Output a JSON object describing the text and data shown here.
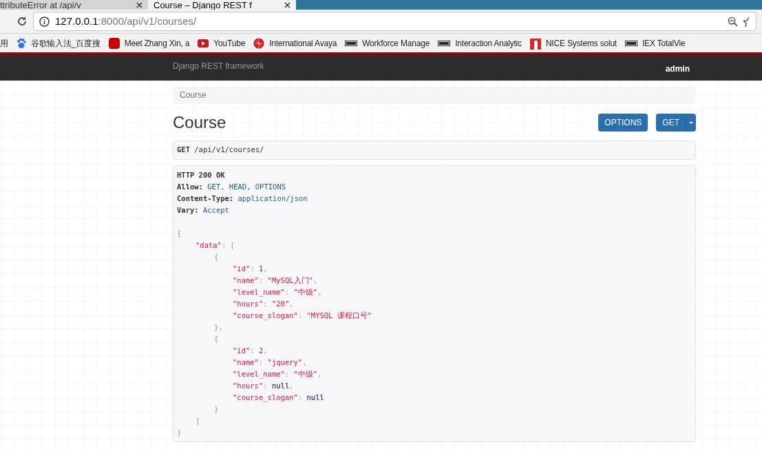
{
  "browser": {
    "tabs": [
      {
        "title": "ttributeError at /api/v",
        "selected": false
      },
      {
        "title": "Course – Django REST f",
        "selected": true
      }
    ],
    "address": {
      "host": "127.0.0.1",
      "rest": ":8000/api/v1/courses/"
    },
    "bookmarks": [
      {
        "label": "用",
        "kind": "text"
      },
      {
        "label": "谷歌输入法_百度搜",
        "kind": "paw"
      },
      {
        "label": "Meet Zhang Xin, a",
        "kind": "cnn"
      },
      {
        "label": "YouTube",
        "kind": "youtube"
      },
      {
        "label": "International Avaya",
        "kind": "globe"
      },
      {
        "label": "Workforce Manage",
        "kind": "nice"
      },
      {
        "label": "Interaction Analytic",
        "kind": "nice"
      },
      {
        "label": "NICE Systems solut",
        "kind": "flag"
      },
      {
        "label": "IEX TotalVie",
        "kind": "nice"
      }
    ]
  },
  "navbar": {
    "brand": "Django REST framework",
    "user": "admin"
  },
  "breadcrumb": "Course",
  "title": "Course",
  "buttons": {
    "options": "OPTIONS",
    "get": "GET"
  },
  "request": {
    "method": "GET",
    "path": "/api/v1/courses/"
  },
  "response": {
    "status": "HTTP 200 OK",
    "headers": [
      {
        "name": "Allow:",
        "value": "GET, HEAD, OPTIONS"
      },
      {
        "name": "Content-Type:",
        "value": "application/json"
      },
      {
        "name": "Vary:",
        "value": "Accept"
      }
    ],
    "body": [
      {
        "tokens": [
          {
            "kind": "punct",
            "text": "{"
          }
        ],
        "children": [
          {
            "tokens": [
              {
                "kind": "key",
                "text": "\"data\""
              },
              {
                "kind": "punct",
                "text": ": ["
              }
            ],
            "children": [
              {
                "tokens": [
                  {
                    "kind": "punct",
                    "text": "{"
                  }
                ],
                "children": [
                  {
                    "tokens": [
                      {
                        "kind": "key",
                        "text": "\"id\""
                      },
                      {
                        "kind": "punct",
                        "text": ": "
                      },
                      {
                        "kind": "number",
                        "text": "1"
                      },
                      {
                        "kind": "punct",
                        "text": ","
                      }
                    ]
                  },
                  {
                    "tokens": [
                      {
                        "kind": "key",
                        "text": "\"name\""
                      },
                      {
                        "kind": "punct",
                        "text": ": "
                      },
                      {
                        "kind": "string",
                        "text": "\"MySQL入门\""
                      },
                      {
                        "kind": "punct",
                        "text": ","
                      }
                    ]
                  },
                  {
                    "tokens": [
                      {
                        "kind": "key",
                        "text": "\"level_name\""
                      },
                      {
                        "kind": "punct",
                        "text": ": "
                      },
                      {
                        "kind": "string",
                        "text": "\"中级\""
                      },
                      {
                        "kind": "punct",
                        "text": ","
                      }
                    ]
                  },
                  {
                    "tokens": [
                      {
                        "kind": "key",
                        "text": "\"hours\""
                      },
                      {
                        "kind": "punct",
                        "text": ": "
                      },
                      {
                        "kind": "string",
                        "text": "\"20\""
                      },
                      {
                        "kind": "punct",
                        "text": ","
                      }
                    ]
                  },
                  {
                    "tokens": [
                      {
                        "kind": "key",
                        "text": "\"course_slogan\""
                      },
                      {
                        "kind": "punct",
                        "text": ": "
                      },
                      {
                        "kind": "string",
                        "text": "\"MYSQL 课程口号\""
                      }
                    ]
                  }
                ]
              },
              {
                "tokens": [
                  {
                    "kind": "punct",
                    "text": "},"
                  }
                ]
              },
              {
                "tokens": [
                  {
                    "kind": "punct",
                    "text": "{"
                  }
                ],
                "children": [
                  {
                    "tokens": [
                      {
                        "kind": "key",
                        "text": "\"id\""
                      },
                      {
                        "kind": "punct",
                        "text": ": "
                      },
                      {
                        "kind": "number",
                        "text": "2"
                      },
                      {
                        "kind": "punct",
                        "text": ","
                      }
                    ]
                  },
                  {
                    "tokens": [
                      {
                        "kind": "key",
                        "text": "\"name\""
                      },
                      {
                        "kind": "punct",
                        "text": ": "
                      },
                      {
                        "kind": "string",
                        "text": "\"jquery\""
                      },
                      {
                        "kind": "punct",
                        "text": ","
                      }
                    ]
                  },
                  {
                    "tokens": [
                      {
                        "kind": "key",
                        "text": "\"level_name\""
                      },
                      {
                        "kind": "punct",
                        "text": ": "
                      },
                      {
                        "kind": "string",
                        "text": "\"中级\""
                      },
                      {
                        "kind": "punct",
                        "text": ","
                      }
                    ]
                  },
                  {
                    "tokens": [
                      {
                        "kind": "key",
                        "text": "\"hours\""
                      },
                      {
                        "kind": "punct",
                        "text": ": "
                      },
                      {
                        "kind": "literal",
                        "text": "null"
                      },
                      {
                        "kind": "punct",
                        "text": ","
                      }
                    ]
                  },
                  {
                    "tokens": [
                      {
                        "kind": "key",
                        "text": "\"course_slogan\""
                      },
                      {
                        "kind": "punct",
                        "text": ": "
                      },
                      {
                        "kind": "literal",
                        "text": "null"
                      }
                    ]
                  }
                ]
              },
              {
                "tokens": [
                  {
                    "kind": "punct",
                    "text": "}"
                  }
                ]
              }
            ]
          },
          {
            "tokens": [
              {
                "kind": "punct",
                "text": "]"
              }
            ]
          }
        ]
      },
      {
        "tokens": [
          {
            "kind": "punct",
            "text": "}"
          }
        ]
      }
    ]
  }
}
